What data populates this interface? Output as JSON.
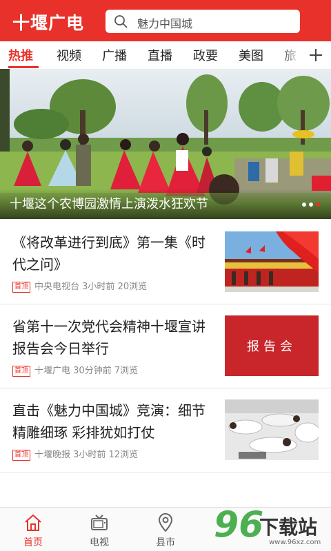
{
  "app": {
    "logo": "十堰广电"
  },
  "search": {
    "text": "魅力中国城"
  },
  "tabs": [
    {
      "label": "热推",
      "active": true
    },
    {
      "label": "视频"
    },
    {
      "label": "广播"
    },
    {
      "label": "直播"
    },
    {
      "label": "政要"
    },
    {
      "label": "美图"
    },
    {
      "label": "旅"
    }
  ],
  "banner": {
    "title": "十堰这个农博园激情上演泼水狂欢节",
    "slides_total": 3,
    "active_slide": 3
  },
  "news": [
    {
      "title": "《将改革进行到底》第一集《时代之问》",
      "tag": "首顶",
      "source": "中央电视台",
      "time": "3小时前",
      "views": "20浏览",
      "thumb": "tiananmen"
    },
    {
      "title": "省第十一次党代会精神十堰宣讲报告会今日举行",
      "tag": "首顶",
      "source": "十堰广电",
      "time": "30分钟前",
      "views": "7浏览",
      "thumb": "报告会"
    },
    {
      "title": "直击《魅力中国城》竞演：细节精雕细琢 彩排犹如打仗",
      "tag": "首顶",
      "source": "十堰晚报",
      "time": "3小时前",
      "views": "12浏览",
      "thumb": "rehearsal"
    }
  ],
  "bottom_nav": [
    {
      "label": "首页",
      "icon": "home-icon",
      "active": true
    },
    {
      "label": "电视",
      "icon": "tv-icon"
    },
    {
      "label": "县市",
      "icon": "location-icon"
    }
  ],
  "watermark": {
    "number": "96",
    "text": "下载站",
    "url": "www.96xz.com"
  },
  "colors": {
    "brand": "#e8312a",
    "text": "#222222",
    "meta": "#888888",
    "divider": "#e4e4e4"
  }
}
